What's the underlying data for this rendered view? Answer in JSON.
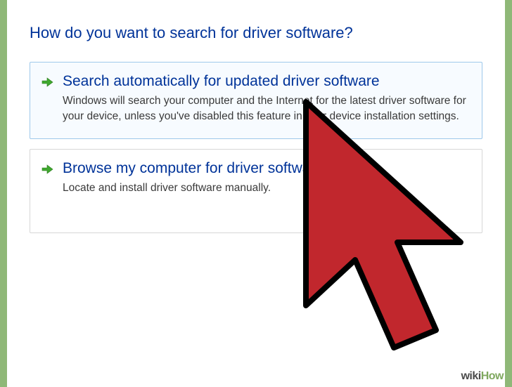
{
  "heading": "How do you want to search for driver software?",
  "options": {
    "auto": {
      "title": "Search automatically for updated driver software",
      "desc": "Windows will search your computer and the Internet for the latest driver software for your device, unless you've disabled this feature in your device installation settings."
    },
    "browse": {
      "title": "Browse my computer for driver software",
      "desc": "Locate and install driver software manually."
    }
  },
  "watermark": {
    "part1": "wiki",
    "part2": "How"
  }
}
